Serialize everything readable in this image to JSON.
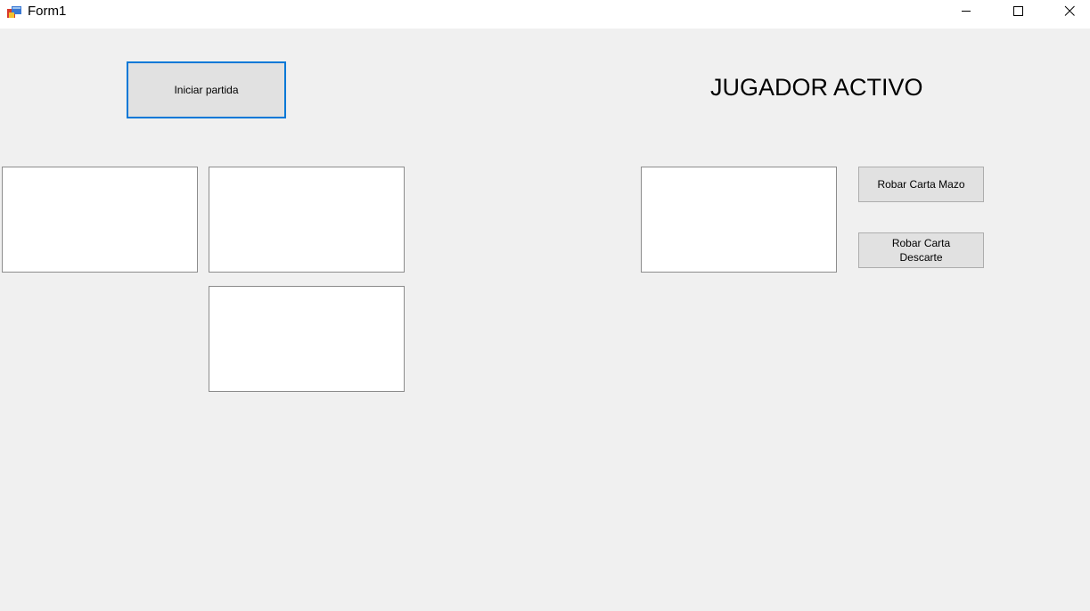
{
  "window": {
    "title": "Form1",
    "icon": "winforms-app-icon",
    "controls": {
      "minimize_icon": "minimize-icon",
      "maximize_icon": "maximize-icon",
      "close_icon": "close-icon"
    }
  },
  "form": {
    "start_button_label": "Iniciar partida",
    "active_player_label": "JUGADOR ACTIVO",
    "draw_deck_button_label": "Robar Carta Mazo",
    "draw_discard_button_label": "Robar Carta\nDescarte",
    "colors": {
      "background": "#f0f0f0",
      "focus_border": "#0078d7",
      "button_face": "#e1e1e1",
      "card_box": "#ffffff"
    }
  }
}
